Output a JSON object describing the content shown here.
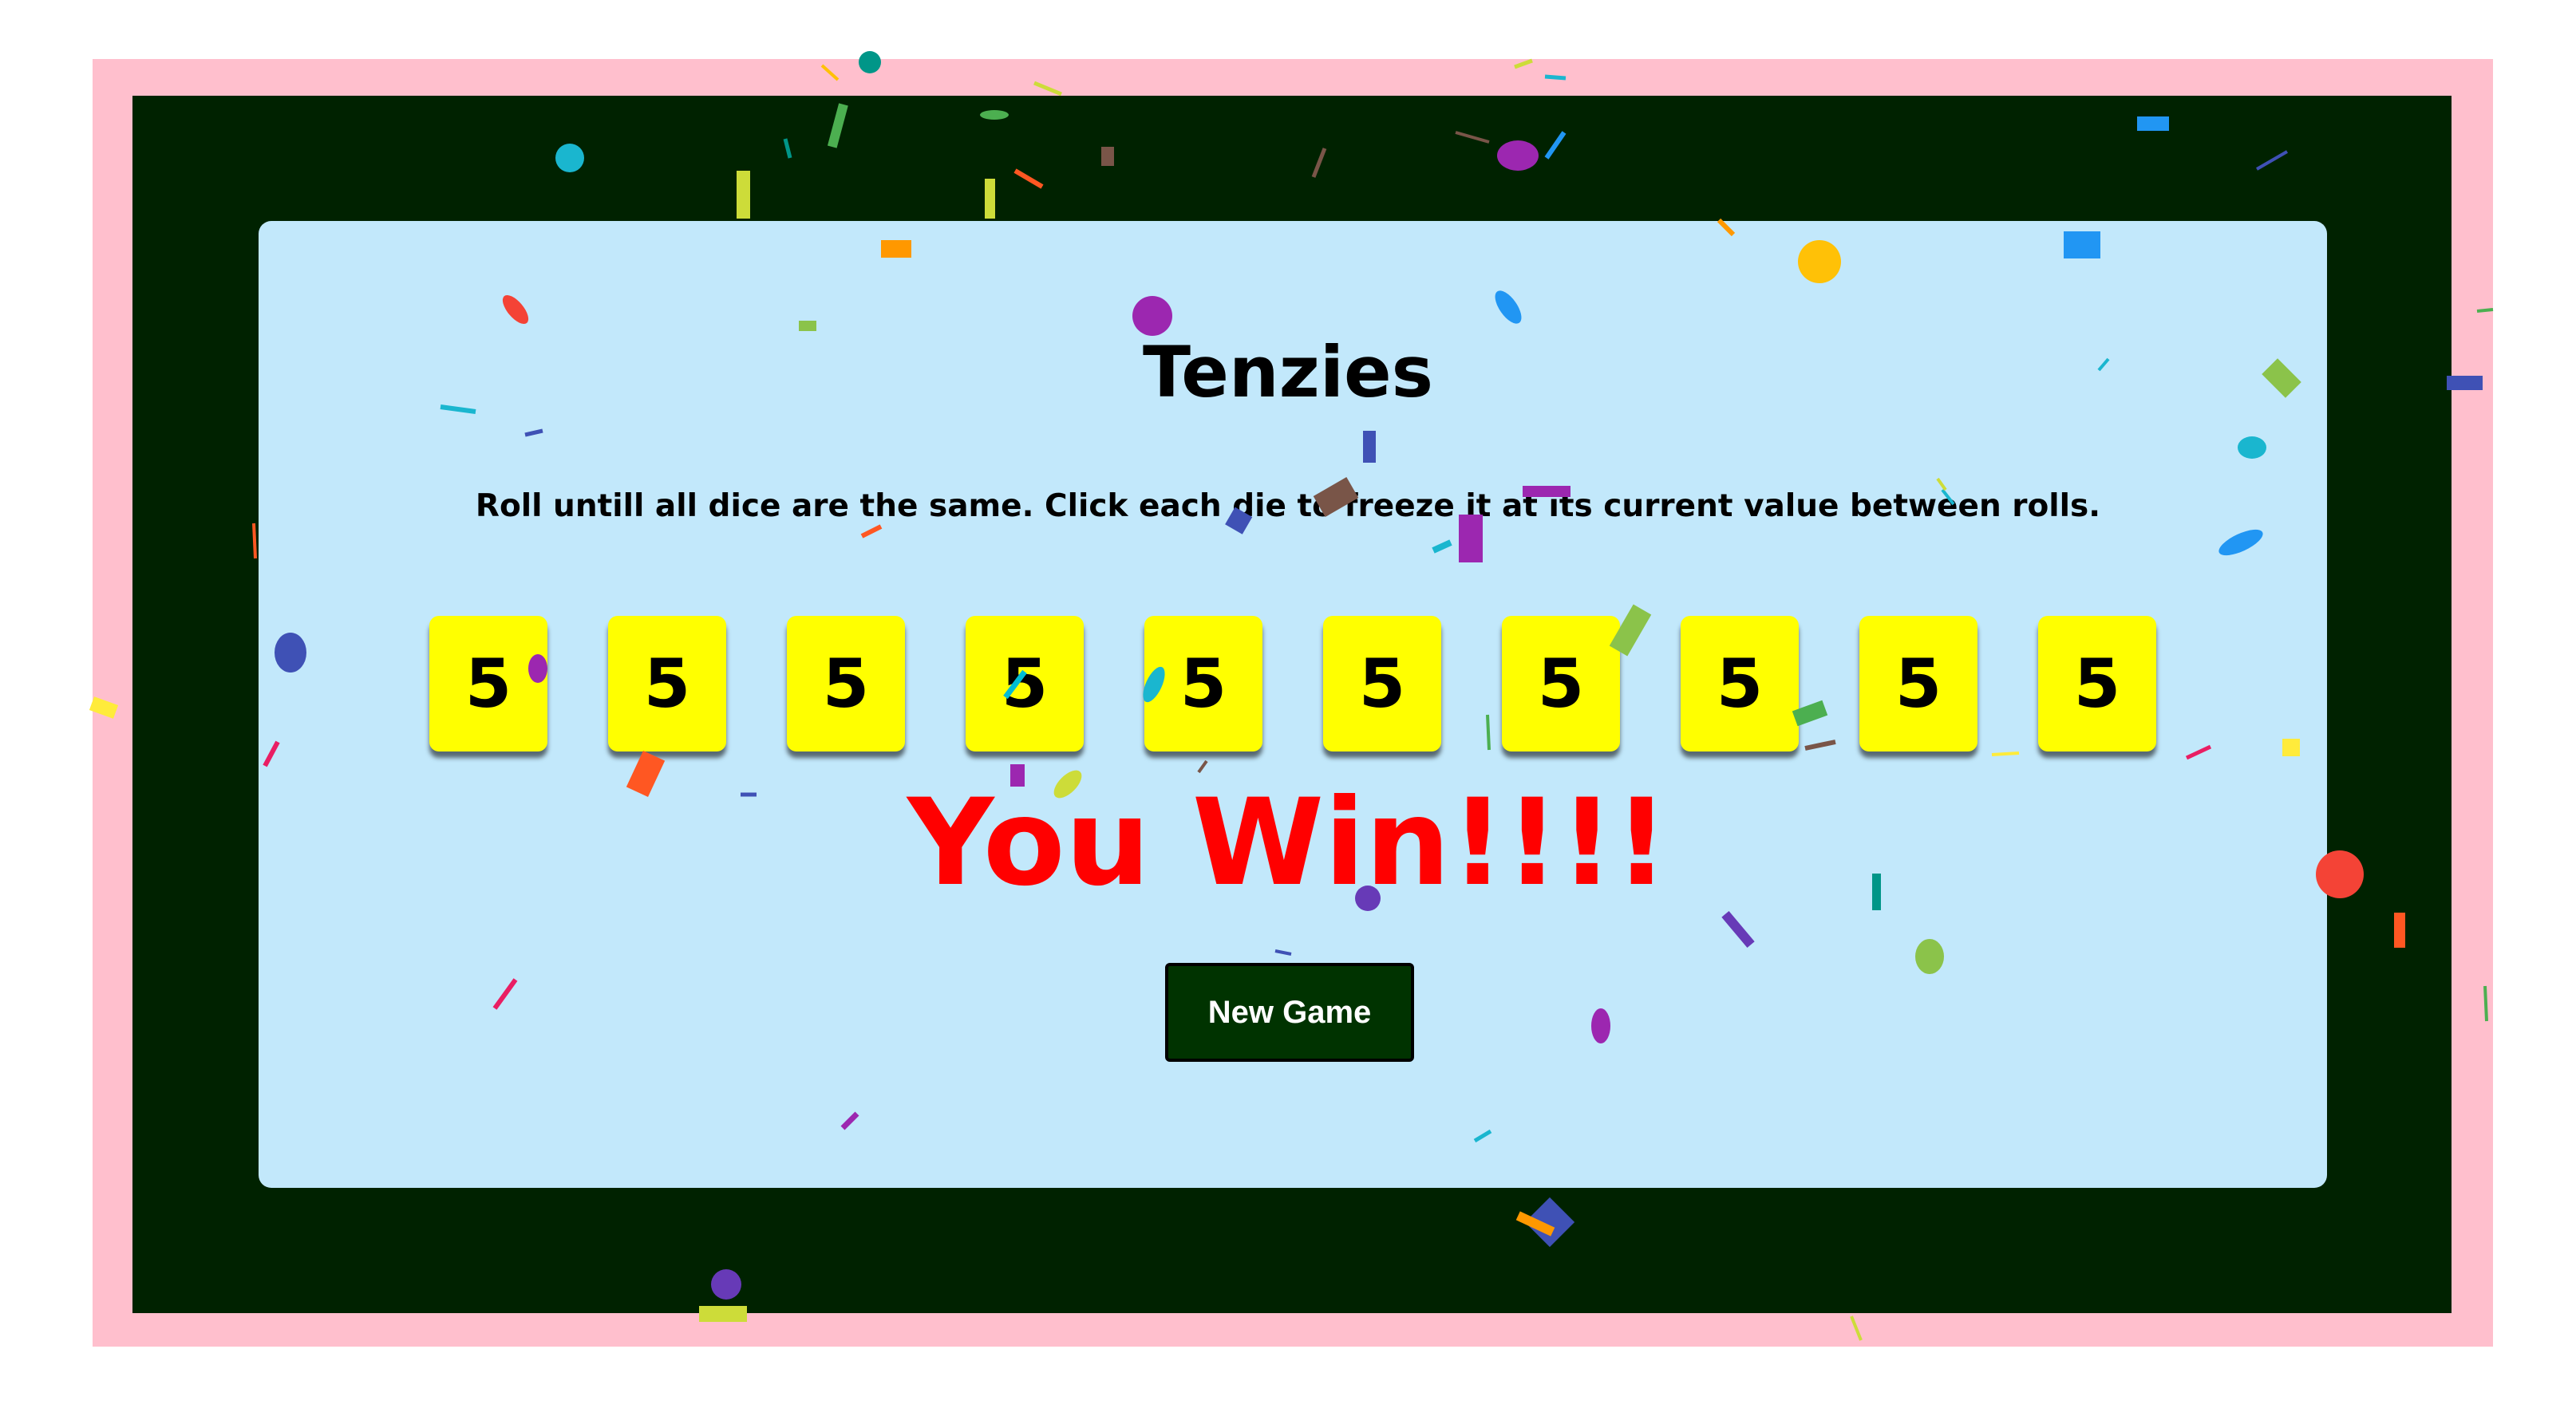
{
  "game": {
    "title": "Tenzies",
    "instructions": "Roll untill all dice are the same. Click each die to freeze it at its current value between rolls.",
    "dice": [
      {
        "value": "5",
        "held": true
      },
      {
        "value": "5",
        "held": true
      },
      {
        "value": "5",
        "held": true
      },
      {
        "value": "5",
        "held": true
      },
      {
        "value": "5",
        "held": true
      },
      {
        "value": "5",
        "held": true
      },
      {
        "value": "5",
        "held": true
      },
      {
        "value": "5",
        "held": true
      },
      {
        "value": "5",
        "held": true
      },
      {
        "value": "5",
        "held": true
      }
    ],
    "win_message": "You Win!!!!",
    "button_label": "New Game"
  },
  "colors": {
    "frame": "#ffbfcd",
    "background": "#002200",
    "card": "#c2e8fb",
    "die_face": "#ffff00",
    "win_text": "#ff0000",
    "button": "#003300"
  }
}
